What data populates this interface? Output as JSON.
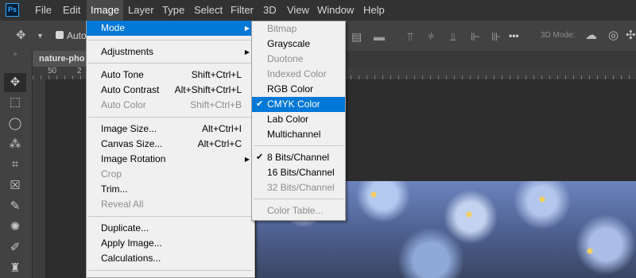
{
  "menubar": {
    "logo": "Ps",
    "items": [
      "File",
      "Edit",
      "Image",
      "Layer",
      "Type",
      "Select",
      "Filter",
      "3D",
      "View",
      "Window",
      "Help"
    ],
    "active": "Image"
  },
  "options_bar": {
    "auto_select_label": "Auto-",
    "mode_3d_label": "3D Mode:",
    "more_label": "•••"
  },
  "document": {
    "tab_label": "nature-pho",
    "ruler_labels": [
      "50",
      "2"
    ]
  },
  "image_menu": {
    "items": [
      {
        "label": "Mode",
        "shortcut": "",
        "submenu": true,
        "disabled": false,
        "highlight": true
      },
      {
        "label": "Adjustments",
        "shortcut": "",
        "submenu": true,
        "disabled": false
      },
      {
        "label": "Auto Tone",
        "shortcut": "Shift+Ctrl+L",
        "disabled": false
      },
      {
        "label": "Auto Contrast",
        "shortcut": "Alt+Shift+Ctrl+L",
        "disabled": false
      },
      {
        "label": "Auto Color",
        "shortcut": "Shift+Ctrl+B",
        "disabled": true
      },
      {
        "label": "Image Size...",
        "shortcut": "Alt+Ctrl+I",
        "disabled": false
      },
      {
        "label": "Canvas Size...",
        "shortcut": "Alt+Ctrl+C",
        "disabled": false
      },
      {
        "label": "Image Rotation",
        "shortcut": "",
        "submenu": true,
        "disabled": false
      },
      {
        "label": "Crop",
        "shortcut": "",
        "disabled": true
      },
      {
        "label": "Trim...",
        "shortcut": "",
        "disabled": false
      },
      {
        "label": "Reveal All",
        "shortcut": "",
        "disabled": true
      },
      {
        "label": "Duplicate...",
        "shortcut": "",
        "disabled": false
      },
      {
        "label": "Apply Image...",
        "shortcut": "",
        "disabled": false
      },
      {
        "label": "Calculations...",
        "shortcut": "",
        "disabled": false
      }
    ]
  },
  "mode_submenu": {
    "items": [
      {
        "label": "Bitmap",
        "disabled": true,
        "checked": false
      },
      {
        "label": "Grayscale",
        "disabled": false,
        "checked": false
      },
      {
        "label": "Duotone",
        "disabled": true,
        "checked": false
      },
      {
        "label": "Indexed Color",
        "disabled": true,
        "checked": false
      },
      {
        "label": "RGB Color",
        "disabled": false,
        "checked": false
      },
      {
        "label": "CMYK Color",
        "disabled": false,
        "checked": true,
        "highlight": true
      },
      {
        "label": "Lab Color",
        "disabled": false,
        "checked": false
      },
      {
        "label": "Multichannel",
        "disabled": false,
        "checked": false
      },
      {
        "label": "8 Bits/Channel",
        "disabled": false,
        "checked": true
      },
      {
        "label": "16 Bits/Channel",
        "disabled": false,
        "checked": false
      },
      {
        "label": "32 Bits/Channel",
        "disabled": true,
        "checked": false
      },
      {
        "label": "Color Table...",
        "disabled": true,
        "checked": false
      }
    ],
    "check_glyph": "✔"
  },
  "icons": [
    "move-icon",
    "marquee-icon",
    "lasso-icon",
    "magic-wand-icon",
    "crop-icon",
    "frame-icon",
    "eyedropper-icon",
    "healing-brush-icon",
    "brush-icon",
    "stamp-icon"
  ],
  "colors": {
    "highlight": "#0078d7",
    "menu_bg": "#f0f0f0",
    "chrome": "#323232"
  }
}
